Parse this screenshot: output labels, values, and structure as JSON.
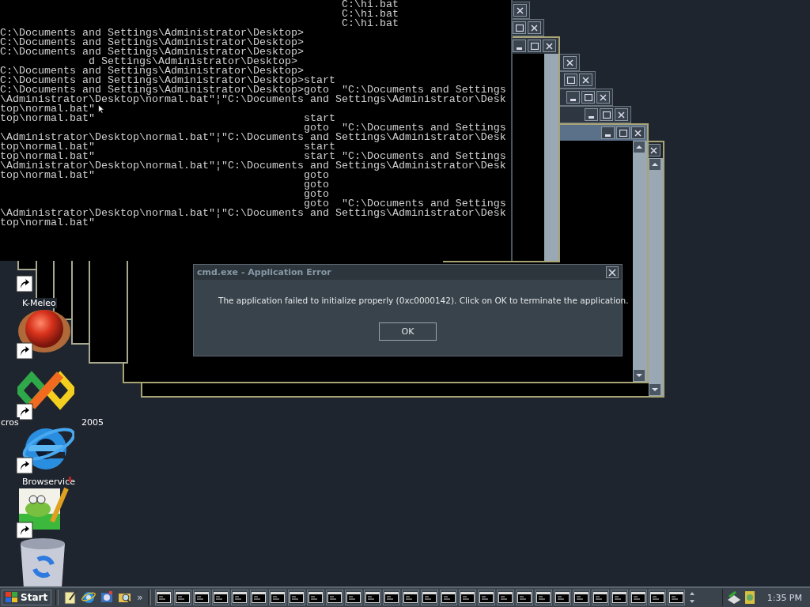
{
  "console": {
    "lines": [
      "                                                      C:\\hi.bat",
      "                                                      C:\\hi.bat",
      "                                                      C:\\hi.bat",
      "C:\\Documents and Settings\\Administrator\\Desktop>",
      "C:\\Documents and Settings\\Administrator\\Desktop>",
      "C:\\Documents and Settings\\Administrator\\Desktop>",
      "              d Settings\\Administrator\\Desktop>",
      "C:\\Documents and Settings\\Administrator\\Desktop>",
      "C:\\Documents and Settings\\Administrator\\Desktop>start",
      "C:\\Documents and Settings\\Administrator\\Desktop>goto  \"C:\\Documents and Settings",
      "\\Administrator\\Desktop\\normal.bat\"¦\"C:\\Documents and Settings\\Administrator\\Desk",
      "top\\normal.bat\"",
      "top\\normal.bat\"                                 start",
      "                                                goto  \"C:\\Documents and Settings",
      "\\Administrator\\Desktop\\normal.bat\"¦\"C:\\Documents and Settings\\Administrator\\Desk",
      "top\\normal.bat\"                                 start",
      "top\\normal.bat\"                                 start \"C:\\Documents and Settings",
      "\\Administrator\\Desktop\\normal.bat\"¦\"C:\\Documents and Settings\\Administrator\\Desk",
      "top\\normal.bat\"                                 goto",
      "                                                goto",
      "                                                goto",
      "                                                goto  \"C:\\Documents and Settings",
      "\\Administrator\\Desktop\\normal.bat\"¦\"C:\\Documents and Settings\\Administrator\\Desk",
      "top\\normal.bat\""
    ]
  },
  "desktop_icons": [
    {
      "kind": "hidden",
      "labels": [
        "K-Meleo"
      ]
    },
    {
      "kind": "ball"
    },
    {
      "kind": "studio",
      "labels": [
        "cros",
        "2005"
      ]
    },
    {
      "kind": "browser",
      "labels": [
        "Browservice"
      ]
    },
    {
      "kind": "notepad"
    },
    {
      "kind": "recycle"
    }
  ],
  "dialog": {
    "title": "cmd.exe - Application Error",
    "message": "The application failed to initialize properly (0xc0000142). Click on OK to terminate the application.",
    "button": "OK"
  },
  "taskbar": {
    "start": "Start",
    "more": "»",
    "clock": "1:35 PM"
  }
}
